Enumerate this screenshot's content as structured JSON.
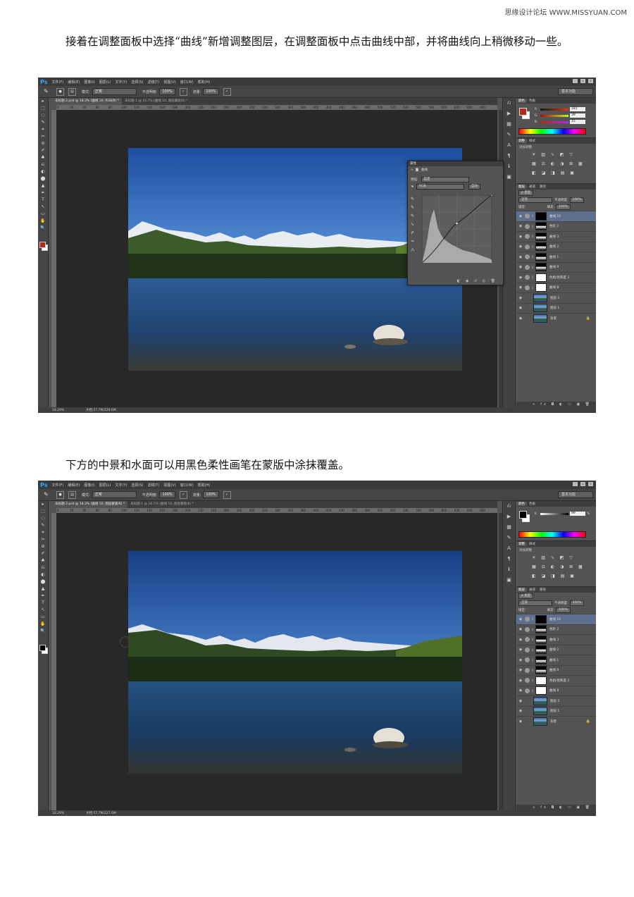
{
  "watermark": "思缘设计论坛 WWW.MISSYUAN.COM",
  "paragraph1": "接着在调整面板中选择“曲线”新增调整图层，在调整面板中点击曲线中部，并将曲线向上稍微移动一些。",
  "paragraph2": "下方的中景和水面可以用黑色柔性画笔在蒙版中涂抹覆盖。",
  "app": {
    "logo": "Ps",
    "menu": [
      "文件(F)",
      "编辑(E)",
      "图像(I)",
      "图层(L)",
      "文字(Y)",
      "选择(S)",
      "滤镜(T)",
      "视图(V)",
      "窗口(W)",
      "帮助(H)"
    ],
    "window_controls": [
      "-",
      "▫",
      "×"
    ],
    "options": {
      "mode_label": "模式:",
      "mode_value": "正常",
      "opacity_label": "不透明度:",
      "opacity_value": "100%",
      "flow_label": "流量:",
      "flow_value": "100%",
      "workspace": "基本功能"
    },
    "ruler_ticks": [
      "0",
      "20",
      "40",
      "60",
      "80",
      "100",
      "120",
      "140",
      "160",
      "180",
      "200",
      "220",
      "240",
      "260",
      "280",
      "300",
      "320",
      "340",
      "360",
      "380",
      "400",
      "420",
      "440",
      "460",
      "480",
      "500",
      "520",
      "540",
      "560",
      "580",
      "600",
      "620",
      "640",
      "660"
    ],
    "toolbox": [
      "▸",
      "⬚",
      "◌",
      "✎",
      "⌗",
      "✂",
      "⊘",
      "✐",
      "♣",
      "⎌",
      "◐",
      "⬤",
      "▲",
      "✒",
      "T",
      "↖",
      "▭",
      "✋",
      "🔍"
    ]
  },
  "shot1": {
    "tabs": [
      "未标题-2.psd @ 18.3% (曲线 10, RGB/8) *",
      "未标题-1 @ 16.7% (曲线 10, 图层蒙版/8) *"
    ],
    "status_zoom": "18.29%",
    "status_doc": "文档:57.7M/226.6M",
    "color_tabs": [
      "颜色",
      "色板"
    ],
    "fg_color": "#b02a1a",
    "bg_color": "#ffffff",
    "rgb": [
      {
        "label": "R",
        "value": "181"
      },
      {
        "label": "G",
        "value": "39"
      },
      {
        "label": "B",
        "value": "15"
      }
    ],
    "adj_tabs": [
      "调整",
      "样式"
    ],
    "adj_title": "添加调整",
    "layers_tabs": [
      "图层",
      "通道",
      "路径"
    ],
    "kind_label": "ρ 类型",
    "blend_mode": "正常",
    "opacity_label": "不透明度:",
    "opacity_value": "100%",
    "lock_label": "锁定:",
    "fill_label": "填充:",
    "fill_value": "100%",
    "layers": [
      {
        "name": "曲线 10",
        "selected": true,
        "type": "adj"
      },
      {
        "name": "色阶 2",
        "selected": false,
        "type": "adj"
      },
      {
        "name": "曲线 3",
        "selected": false,
        "type": "adj"
      },
      {
        "name": "曲线 2",
        "selected": false,
        "type": "adj"
      },
      {
        "name": "曲线 1",
        "selected": false,
        "type": "adj"
      },
      {
        "name": "曲线 9",
        "selected": false,
        "type": "adj"
      },
      {
        "name": "色相/饱和度 2",
        "selected": false,
        "type": "adj"
      },
      {
        "name": "曲线 8",
        "selected": false,
        "type": "adj"
      },
      {
        "name": "图层 3",
        "selected": false,
        "type": "img"
      },
      {
        "name": "图层 1",
        "selected": false,
        "type": "img"
      },
      {
        "name": "背景",
        "selected": false,
        "type": "img",
        "locked": true
      }
    ],
    "properties": {
      "header": "属性",
      "title": "曲线",
      "preset_label": "预设:",
      "preset_value": "自定",
      "channel_value": "RGB",
      "auto_button": "自动"
    }
  },
  "shot2": {
    "tabs": [
      "未标题-2.psd @ 18.3% (曲线 10, 图层蒙版/8) *",
      "未标题-1 @ 16.7% (曲线 10, 图层蒙版/8) *"
    ],
    "status_zoom": "18.29%",
    "status_doc": "文档:57.7M/227.6M",
    "color_tabs": [
      "颜色",
      "色板"
    ],
    "fg_color": "#000000",
    "bg_color": "#ffffff",
    "k_label": "K",
    "k_value": "99",
    "k_unit": "%",
    "adj_tabs": [
      "调整",
      "样式"
    ],
    "adj_title": "添加调整",
    "layers_tabs": [
      "图层",
      "通道",
      "路径"
    ],
    "kind_label": "ρ 类型",
    "blend_mode": "正常",
    "opacity_label": "不透明度:",
    "opacity_value": "100%",
    "lock_label": "锁定:",
    "fill_label": "填充:",
    "fill_value": "100%",
    "layers": [
      {
        "name": "曲线 10",
        "selected": true,
        "type": "adj"
      },
      {
        "name": "色阶 2",
        "selected": false,
        "type": "adj"
      },
      {
        "name": "曲线 3",
        "selected": false,
        "type": "adj"
      },
      {
        "name": "曲线 2",
        "selected": false,
        "type": "adj"
      },
      {
        "name": "曲线 1",
        "selected": false,
        "type": "adj"
      },
      {
        "name": "曲线 9",
        "selected": false,
        "type": "adj"
      },
      {
        "name": "色相/饱和度 2",
        "selected": false,
        "type": "adj"
      },
      {
        "name": "曲线 8",
        "selected": false,
        "type": "adj"
      },
      {
        "name": "图层 3",
        "selected": false,
        "type": "img"
      },
      {
        "name": "图层 1",
        "selected": false,
        "type": "img"
      },
      {
        "name": "背景",
        "selected": false,
        "type": "img",
        "locked": true
      }
    ]
  }
}
